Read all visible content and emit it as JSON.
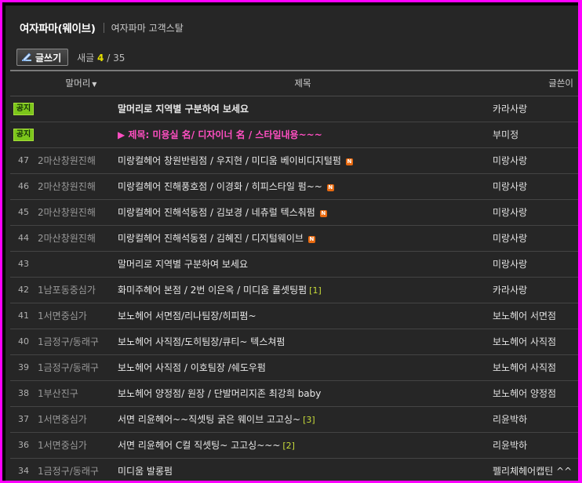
{
  "header": {
    "cafe_name": "여자파마(웨이브)",
    "board_name": "여자파마 고객스탈"
  },
  "toolbar": {
    "write_label": "글쓰기",
    "new_label": "새글",
    "new_count": "4",
    "total": "/ 35"
  },
  "columns": {
    "head": "말머리",
    "title": "제목",
    "author": "글쓴이"
  },
  "notice_label": "공지",
  "rows": [
    {
      "num": "",
      "notice": true,
      "head": "",
      "title": "말머리로 지역별 구분하여 보세요",
      "reply": "",
      "new": false,
      "author": "카라사랑",
      "style": "bold"
    },
    {
      "num": "",
      "notice": true,
      "head": "",
      "title": "▶ 제목: 미용실 名/ 디자이너 名 / 스타일내용~~~",
      "reply": "",
      "new": false,
      "author": "부미정",
      "style": "pink"
    },
    {
      "num": "47",
      "notice": false,
      "head": "2마산창원진해",
      "title": "미랑컬헤어 창원반림점 / 우지현 / 미디움 베이비디지털펌",
      "reply": "",
      "new": true,
      "author": "미랑사랑",
      "style": ""
    },
    {
      "num": "46",
      "notice": false,
      "head": "2마산창원진해",
      "title": "미랑컬헤어 진해풍호점 / 이경화 / 히피스타일 펌~~",
      "reply": "",
      "new": true,
      "author": "미랑사랑",
      "style": ""
    },
    {
      "num": "45",
      "notice": false,
      "head": "2마산창원진해",
      "title": "미랑컬헤어 진해석동점 / 김보경 / 네츄럴 텍스춰펌",
      "reply": "",
      "new": true,
      "author": "미랑사랑",
      "style": ""
    },
    {
      "num": "44",
      "notice": false,
      "head": "2마산창원진해",
      "title": "미랑컬헤어 진해석동점 / 김혜진 / 디지털웨이브",
      "reply": "",
      "new": true,
      "author": "미랑사랑",
      "style": ""
    },
    {
      "num": "43",
      "notice": false,
      "head": "",
      "title": "말머리로 지역별 구분하여 보세요",
      "reply": "",
      "new": false,
      "author": "미랑사랑",
      "style": ""
    },
    {
      "num": "42",
      "notice": false,
      "head": "1남포동중심가",
      "title": "화미주헤어 본점 / 2번 이은옥 / 미디움 롤셋팅펌",
      "reply": "[1]",
      "new": false,
      "author": "카라사랑",
      "style": ""
    },
    {
      "num": "41",
      "notice": false,
      "head": "1서면중심가",
      "title": "보노헤어 서면점/리나팀장/히피펌~",
      "reply": "",
      "new": false,
      "author": "보노헤어 서면점",
      "style": ""
    },
    {
      "num": "40",
      "notice": false,
      "head": "1금정구/동래구",
      "title": "보노헤어 사직점/도히팀장/큐티~ 텍스쳐펌",
      "reply": "",
      "new": false,
      "author": "보노헤어 사직점",
      "style": ""
    },
    {
      "num": "39",
      "notice": false,
      "head": "1금정구/동래구",
      "title": "보노헤어 사직점 / 이호팀장 /쉐도우펌",
      "reply": "",
      "new": false,
      "author": "보노헤어 사직점",
      "style": ""
    },
    {
      "num": "38",
      "notice": false,
      "head": "1부산진구",
      "title": "보노헤어 양정점/ 원장 / 단발머리지존 최강희 baby",
      "reply": "",
      "new": false,
      "author": "보노헤어 양정점",
      "style": ""
    },
    {
      "num": "37",
      "notice": false,
      "head": "1서면중심가",
      "title": "서면 리윤헤어~~직셋팅 굵은 웨이브 고고싱~",
      "reply": "[3]",
      "new": false,
      "author": "리윤박하",
      "style": ""
    },
    {
      "num": "36",
      "notice": false,
      "head": "1서면중심가",
      "title": "서면 리윤헤어 C컬 직셋팅~ 고고싱~~~",
      "reply": "[2]",
      "new": false,
      "author": "리윤박하",
      "style": ""
    },
    {
      "num": "34",
      "notice": false,
      "head": "1금정구/동래구",
      "title": "미디움 발롱펌",
      "reply": "",
      "new": false,
      "author": "펠리체헤어캡틴 ^^",
      "style": ""
    }
  ],
  "colors": {
    "background": "#262626",
    "frame": "#ff00ff",
    "notice_badge": "#7cc61b",
    "pink_title": "#ff4fc2",
    "new_count": "#e6e000",
    "new_icon": "#e86a10"
  },
  "icons": [
    "pen-icon",
    "new-icon",
    "chevron-down-icon"
  ]
}
